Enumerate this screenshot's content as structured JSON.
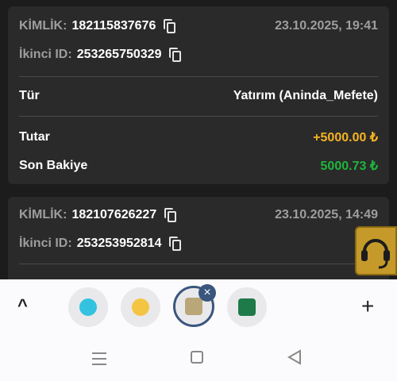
{
  "transactions": [
    {
      "kimlik_label": "KİMLİK:",
      "kimlik": "182115837676",
      "date": "23.10.2025, 19:41",
      "ikinci_label": "İkinci ID:",
      "ikinci": "253265750329",
      "tur_label": "Tür",
      "tur": "Yatırım (Aninda_Mefete)",
      "tutar_label": "Tutar",
      "tutar": "+5000.00 ₺",
      "bakiye_label": "Son Bakiye",
      "bakiye": "5000.73 ₺"
    },
    {
      "kimlik_label": "KİMLİK:",
      "kimlik": "182107626227",
      "date": "23.10.2025, 14:49",
      "ikinci_label": "İkinci ID:",
      "ikinci": "253253952814"
    }
  ],
  "colors": {
    "background": "#1c1c1d",
    "card": "#2a2a2b",
    "amount": "#f5b321",
    "balance": "#1fb53b",
    "support_button": "#c59a2a",
    "tab_active_ring": "#3a567e"
  },
  "tabs": {
    "chevron": "^",
    "close_badge": "×",
    "add": "+",
    "icons": [
      "bird-app-icon",
      "glasses-app-icon",
      "link-app-icon",
      "wallet-app-icon"
    ]
  },
  "nav": {
    "recents": "recents-icon",
    "home": "home-icon",
    "back": "back-icon"
  }
}
